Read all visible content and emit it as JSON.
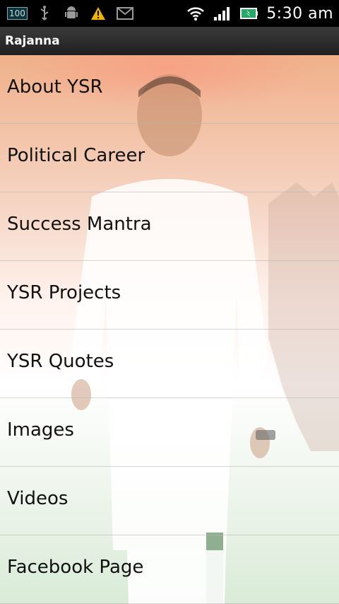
{
  "status_bar": {
    "battery_level": "100",
    "time": "5:30 am",
    "icons": [
      "battery-level-icon",
      "usb-icon",
      "android-debug-icon",
      "warning-icon",
      "gmail-icon",
      "wifi-icon",
      "signal-icon",
      "battery-icon"
    ]
  },
  "title_bar": {
    "title": "Rajanna"
  },
  "menu": {
    "items": [
      {
        "label": "About YSR"
      },
      {
        "label": "Political Career"
      },
      {
        "label": "Success Mantra"
      },
      {
        "label": "YSR Projects"
      },
      {
        "label": "YSR Quotes"
      },
      {
        "label": "Images"
      },
      {
        "label": "Videos"
      },
      {
        "label": "Facebook Page"
      }
    ]
  },
  "colors": {
    "status_bar_bg": "#000000",
    "title_bar_bg": "#2b2b2b",
    "text": "#111111"
  }
}
